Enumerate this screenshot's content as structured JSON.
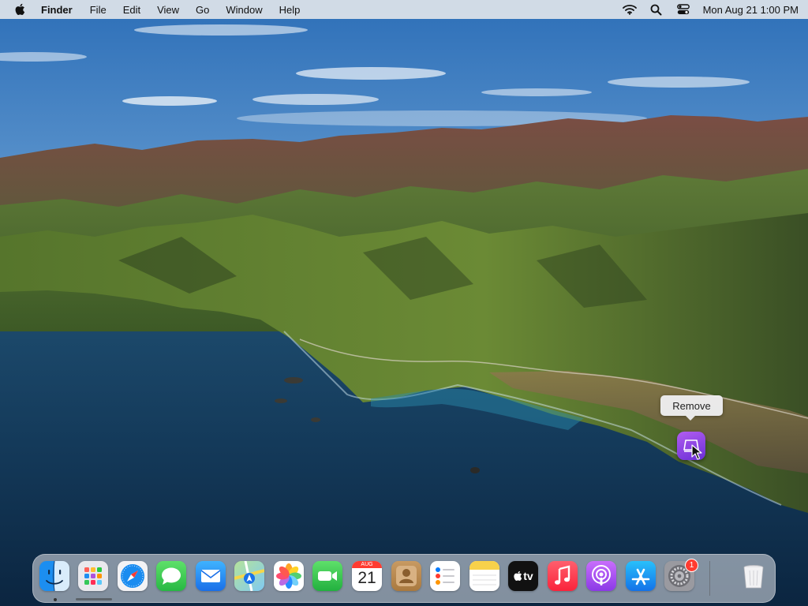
{
  "menubar": {
    "app_name": "Finder",
    "menus": [
      "File",
      "Edit",
      "View",
      "Go",
      "Window",
      "Help"
    ],
    "clock": "Mon Aug 21  1:00 PM"
  },
  "tooltip": {
    "label": "Remove"
  },
  "dock": {
    "apps": [
      {
        "name": "finder-icon"
      },
      {
        "name": "launchpad-icon"
      },
      {
        "name": "safari-icon"
      },
      {
        "name": "messages-icon"
      },
      {
        "name": "mail-icon"
      },
      {
        "name": "maps-icon"
      },
      {
        "name": "photos-icon"
      },
      {
        "name": "facetime-icon"
      },
      {
        "name": "calendar-icon",
        "month": "AUG",
        "day": "21"
      },
      {
        "name": "contacts-icon"
      },
      {
        "name": "reminders-icon"
      },
      {
        "name": "notes-icon"
      },
      {
        "name": "apple-tv-icon",
        "label": "tv"
      },
      {
        "name": "music-icon"
      },
      {
        "name": "podcasts-icon"
      },
      {
        "name": "app-store-icon"
      },
      {
        "name": "system-preferences-icon"
      }
    ],
    "system_preferences_badge": "1",
    "trash": {
      "name": "trash-icon"
    }
  },
  "colors": {
    "sky_top": "#3f7fc4",
    "sky_horizon": "#dbe8f2",
    "ocean": "#10304d",
    "hills_green": "#4f6d2c",
    "hills_brown": "#6b4a3a",
    "badge": "#ff3b30"
  }
}
